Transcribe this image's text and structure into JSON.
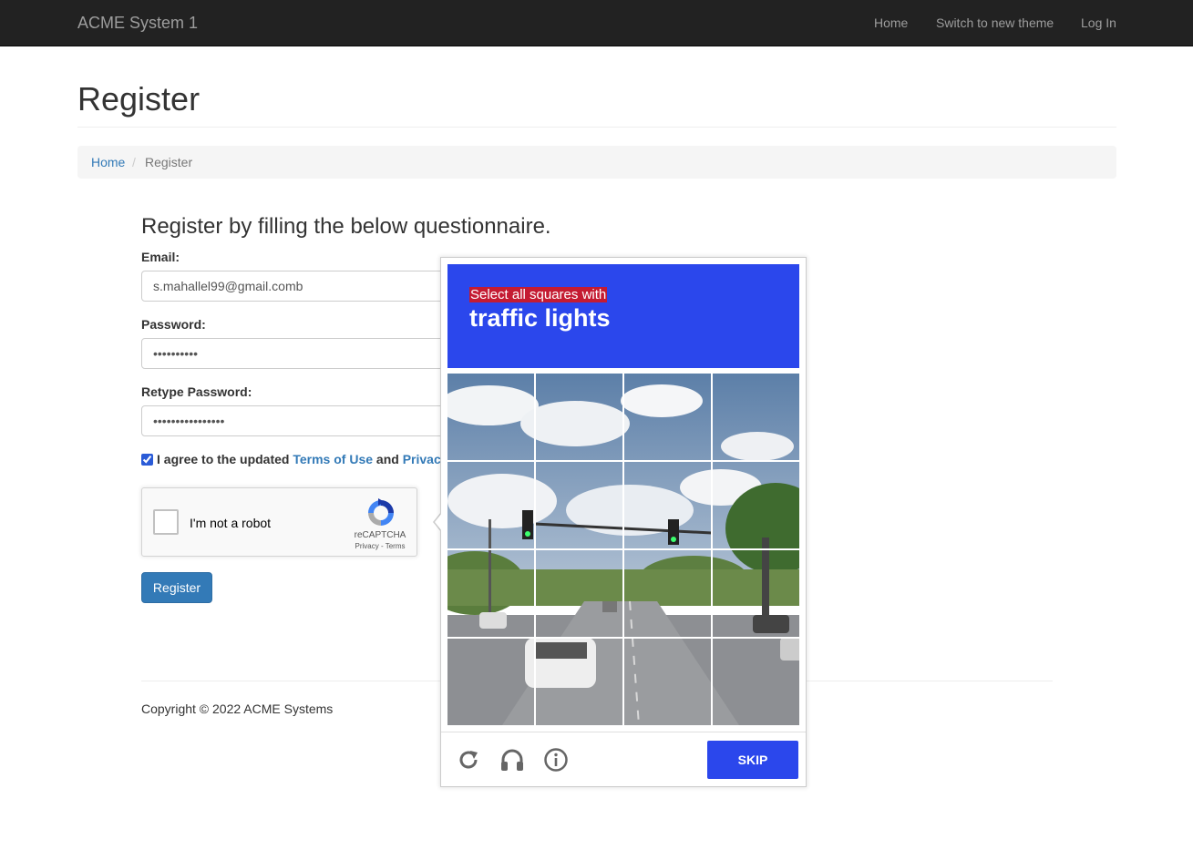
{
  "navbar": {
    "brand": "ACME System 1",
    "links": [
      "Home",
      "Switch to new theme",
      "Log In"
    ]
  },
  "page": {
    "title": "Register",
    "breadcrumb": {
      "home": "Home",
      "separator": "/",
      "current": "Register"
    }
  },
  "form": {
    "heading": "Register by filling the below questionnaire.",
    "email": {
      "label": "Email:",
      "value": "s.mahallel99@gmail.comb"
    },
    "password": {
      "label": "Password:",
      "value": "••••••••••"
    },
    "retype": {
      "label": "Retype Password:",
      "value": "••••••••••••••••"
    },
    "agree": {
      "checked": true,
      "prefix": "I agree to the updated",
      "terms": "Terms of Use",
      "and": "and",
      "privacy": "Privac"
    },
    "recaptcha": {
      "label": "I'm not a robot",
      "brand": "reCAPTCHA",
      "links": "Privacy - Terms"
    },
    "submit": "Register"
  },
  "footer": {
    "copyright": "Copyright © 2022 ACME Systems"
  },
  "challenge": {
    "instruction": "Select all squares with",
    "target": "traffic lights",
    "skip": "SKIP",
    "icons": [
      "reload-icon",
      "audio-icon",
      "info-icon"
    ],
    "colors": {
      "accent": "#2b47ec",
      "highlight": "#c41b32"
    }
  }
}
